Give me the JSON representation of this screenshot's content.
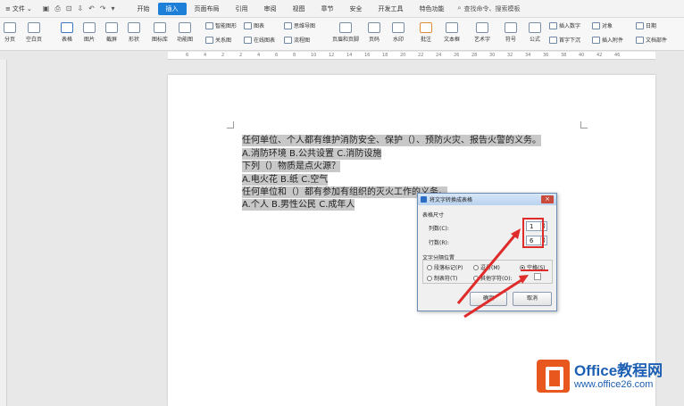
{
  "menubar": {
    "file_label": "文件",
    "tabs": [
      {
        "label": "开始",
        "active": false
      },
      {
        "label": "插入",
        "active": true
      },
      {
        "label": "页面布局",
        "active": false
      },
      {
        "label": "引用",
        "active": false
      },
      {
        "label": "审阅",
        "active": false
      },
      {
        "label": "视图",
        "active": false
      },
      {
        "label": "章节",
        "active": false
      },
      {
        "label": "安全",
        "active": false
      },
      {
        "label": "开发工具",
        "active": false
      },
      {
        "label": "特色功能",
        "active": false
      }
    ],
    "search_label": "查找命令、搜索模板",
    "accent_color": "#1e7fd8"
  },
  "ribbon": {
    "items": [
      "分页",
      "空白页",
      "表格",
      "图片",
      "截屏",
      "形状",
      "图标库",
      "功能图",
      "图表",
      "在线图表",
      "思维导图",
      "流程图",
      "页眉和页脚",
      "页码",
      "水印",
      "批注",
      "文本框",
      "艺术字",
      "符号",
      "公式",
      "插入数字",
      "首字下沉",
      "对象",
      "插入附件",
      "日期",
      "文档部件"
    ],
    "small": {
      "smart": "智能图形",
      "relation": "关系图"
    }
  },
  "document": {
    "lines": [
      "任何单位、个人都有维护消防安全、保护（）、预防火灾、报告火警的义务。",
      "A.消防环境   B.公共设置   C.消防设施",
      "下列（）物质是点火源？",
      "A.电火花   B.纸   C.空气",
      "任何单位和（）都有参加有组织的灭火工作的义务。",
      "A.个人   B.男性公民   C.成年人"
    ]
  },
  "dialog": {
    "title": "将文字转换成表格",
    "size_group": "表格尺寸",
    "columns_label": "列数(C):",
    "columns_value": "1",
    "rows_label": "行数(R):",
    "rows_value": "6",
    "sep_group": "文字分隔位置",
    "opt_para": "段落标记(P)",
    "opt_comma": "逗号(M)",
    "opt_space": "空格(S)",
    "opt_tab": "制表符(T)",
    "opt_other": "其他字符(O):",
    "other_value": "-",
    "ok": "确定",
    "cancel": "取消"
  },
  "ruler_ticks": [
    "6",
    "4",
    "2",
    "2",
    "4",
    "6",
    "8",
    "10",
    "12",
    "14",
    "16",
    "18",
    "20",
    "22",
    "24",
    "26",
    "28",
    "30",
    "32",
    "34",
    "36",
    "38",
    "40",
    "42",
    "46"
  ],
  "watermark": {
    "line1": "Office教程网",
    "line2": "www.office26.com"
  }
}
